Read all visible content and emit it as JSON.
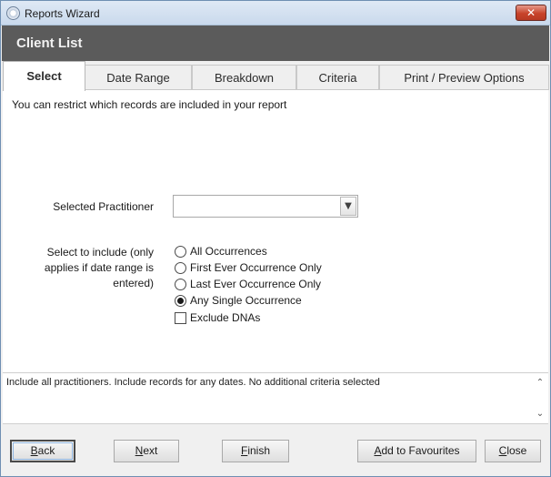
{
  "window": {
    "title": "Reports Wizard",
    "close_glyph": "✕"
  },
  "header": {
    "title": "Client List"
  },
  "tabs": [
    {
      "label": "Select"
    },
    {
      "label": "Date Range"
    },
    {
      "label": "Breakdown"
    },
    {
      "label": "Criteria"
    },
    {
      "label": "Print / Preview Options"
    }
  ],
  "select_panel": {
    "intro": "You can restrict which records are included in your report",
    "practitioner_label": "Selected Practitioner",
    "practitioner_value": "",
    "include_label": "Select to include   (only applies if date range is entered)",
    "options": [
      {
        "label": "All Occurrences",
        "checked": false
      },
      {
        "label": "First Ever Occurrence Only",
        "checked": false
      },
      {
        "label": "Last Ever Occurrence Only",
        "checked": false
      },
      {
        "label": "Any Single Occurrence",
        "checked": true
      }
    ],
    "exclude_dnas": {
      "label": "Exclude DNAs",
      "checked": false
    }
  },
  "summary": {
    "text": "Include all practitioners. Include records for any dates. No additional criteria selected"
  },
  "buttons": {
    "back": {
      "mnemonic": "B",
      "rest": "ack"
    },
    "next": {
      "mnemonic": "N",
      "rest": "ext"
    },
    "finish": {
      "mnemonic": "F",
      "rest": "inish"
    },
    "add_favourites": {
      "mnemonic": "A",
      "rest": "dd to Favourites"
    },
    "close": {
      "mnemonic": "C",
      "rest": "lose"
    }
  },
  "icons": {
    "combo_arrow": "chevron-down-icon",
    "scroll_up": "chevron-up-icon",
    "scroll_down": "chevron-down-icon"
  }
}
